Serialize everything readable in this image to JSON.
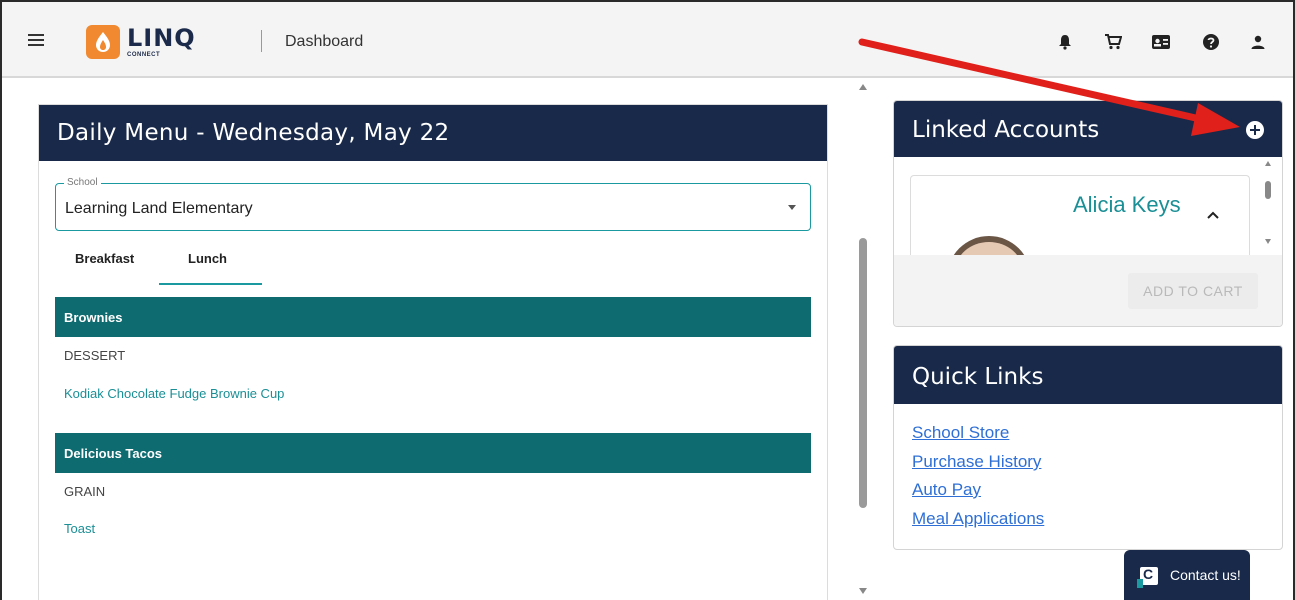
{
  "header": {
    "logo_text": "LINQ",
    "logo_sub": "CONNECT",
    "page_title": "Dashboard",
    "icons": [
      "bell-icon",
      "cart-icon",
      "id-card-icon",
      "help-icon",
      "user-icon"
    ]
  },
  "daily_menu": {
    "title": "Daily Menu - Wednesday, May 22",
    "school_label": "School",
    "school_value": "Learning Land Elementary",
    "tabs": [
      "Breakfast",
      "Lunch"
    ],
    "active_tab": "Lunch",
    "categories": [
      {
        "name": "Brownies",
        "type": "DESSERT",
        "item": "Kodiak Chocolate Fudge Brownie Cup"
      },
      {
        "name": "Delicious Tacos",
        "type": "GRAIN",
        "item": "Toast"
      }
    ]
  },
  "linked_accounts": {
    "title": "Linked Accounts",
    "student_name": "Alicia Keys",
    "add_to_cart": "ADD TO CART"
  },
  "quick_links": {
    "title": "Quick Links",
    "links": [
      "School Store",
      "Purchase History",
      "Auto Pay",
      "Meal Applications"
    ]
  },
  "contact": {
    "label": "Contact us!"
  },
  "colors": {
    "navy": "#19294a",
    "teal": "#0e6b70",
    "accent_teal": "#1a9aa0",
    "annotation_arrow": "#e0201a"
  }
}
